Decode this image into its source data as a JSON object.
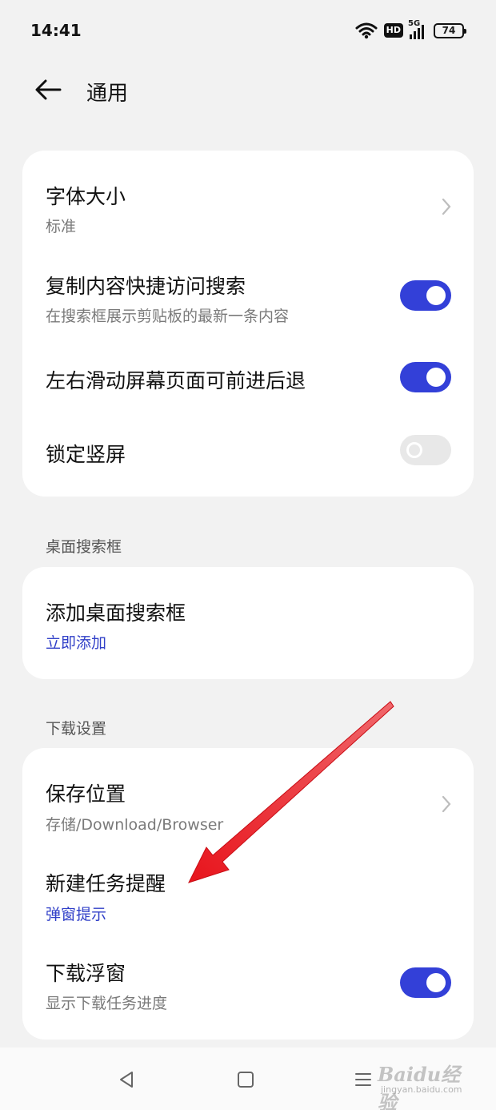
{
  "status_bar": {
    "time": "14:41",
    "hd": "HD",
    "signal": "5G",
    "battery": "74"
  },
  "header": {
    "title": "通用",
    "back_icon": "back-arrow-icon"
  },
  "card1": {
    "font_size": {
      "title": "字体大小",
      "value": "标准"
    },
    "copy_search": {
      "title": "复制内容快捷访问搜索",
      "subtitle": "在搜索框展示剪贴板的最新一条内容",
      "on": true
    },
    "swipe_nav": {
      "title": "左右滑动屏幕页面可前进后退",
      "on": true
    },
    "lock_portrait": {
      "title": "锁定竖屏",
      "on": false
    }
  },
  "section_desktop": {
    "label": "桌面搜索框",
    "add": {
      "title": "添加桌面搜索框",
      "action": "立即添加"
    }
  },
  "section_download": {
    "label": "下载设置",
    "save_location": {
      "title": "保存位置",
      "value": "存储/Download/Browser"
    },
    "task_reminder": {
      "title": "新建任务提醒",
      "value": "弹窗提示"
    },
    "float_window": {
      "title": "下载浮窗",
      "subtitle": "显示下载任务进度",
      "on": true
    }
  },
  "watermark": {
    "text": "Baidu经验",
    "sub": "jingyan.baidu.com"
  },
  "colors": {
    "accent": "#3340d8",
    "link": "#3140c8",
    "arrow": "#e8141c"
  }
}
